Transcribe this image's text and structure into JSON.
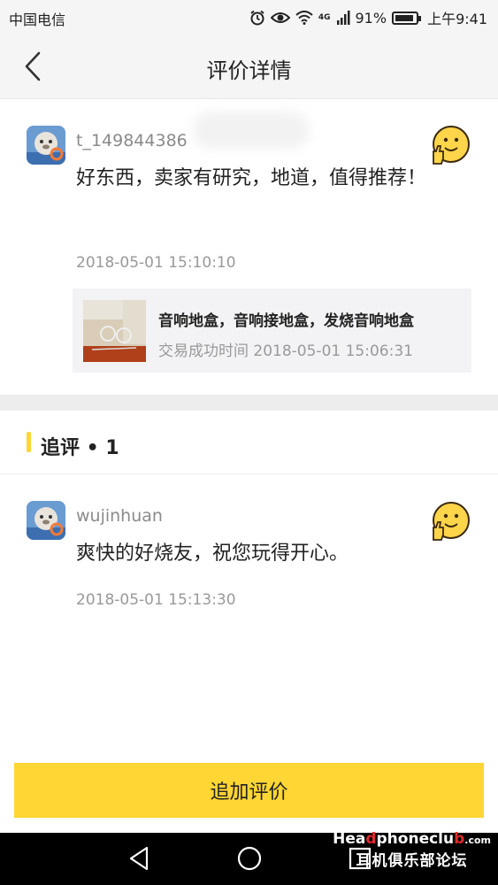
{
  "status_bar": {
    "carrier": "中国电信",
    "network_badge": "4G",
    "battery": "91%",
    "battery_level": 0.91,
    "time": "上午9:41",
    "icons": [
      "alarm-icon",
      "eye-icon",
      "wifi-icon",
      "signal-icon",
      "battery-icon"
    ]
  },
  "nav": {
    "title": "评价详情",
    "back_icon": "chevron-left-icon"
  },
  "review": {
    "username": "t_149844386",
    "content": "好东西，卖家有研究，地道，值得推荐！",
    "time": "2018-05-01 15:10:10",
    "rating_icon": "thumbs-up-emoji-icon"
  },
  "product": {
    "name": "音响地盒，音响接地盒，发烧音响地盒",
    "trade_time": "交易成功时间 2018-05-01 15:06:31"
  },
  "followup": {
    "title": "追评 • 1",
    "username": "wujinhuan",
    "content": "爽快的好烧友，祝您玩得开心。",
    "time": "2018-05-01 15:13:30",
    "rating_icon": "thumbs-up-emoji-icon"
  },
  "action": {
    "add_review_label": "追加评价"
  },
  "system_nav": {
    "icons": [
      "back-triangle-icon",
      "home-circle-icon",
      "recents-square-icon"
    ]
  },
  "watermark": {
    "part1": "Hea",
    "part2": "d",
    "part3": "phoneclu",
    "part4": "b",
    "suffix": ".com",
    "subtitle": "耳机俱乐部论坛"
  },
  "colors": {
    "accent": "#ffd633",
    "background": "#ffffff",
    "header_bg": "#f5f5f5",
    "muted_text": "#999999",
    "separator": "#ededed"
  }
}
